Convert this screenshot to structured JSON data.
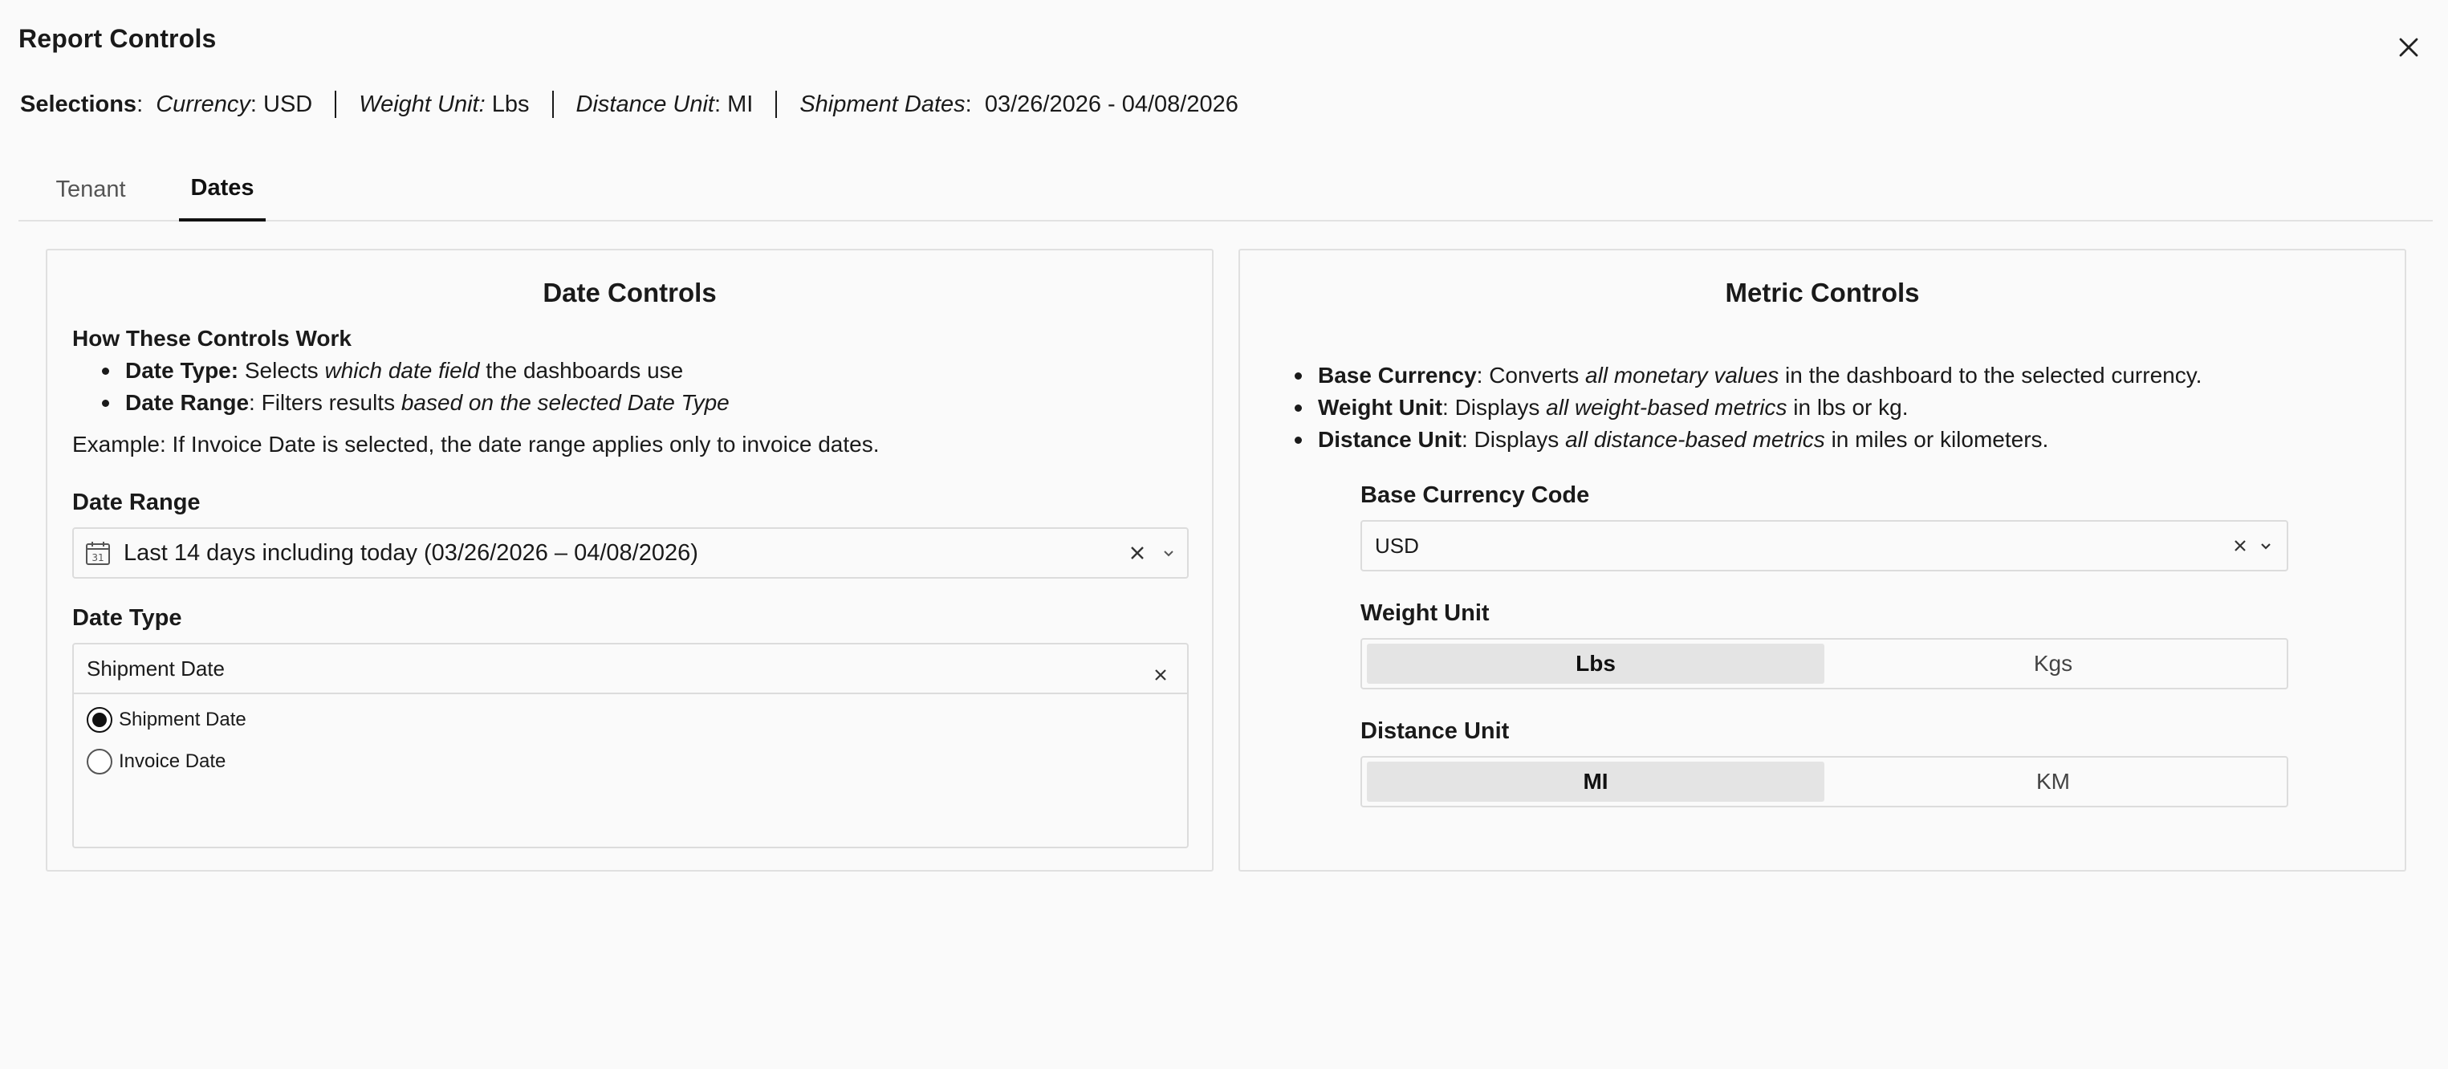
{
  "header": {
    "title": "Report Controls"
  },
  "selections": {
    "label": "Selections",
    "currency_label": "Currency",
    "currency_value": "USD",
    "weight_label": "Weight Unit:",
    "weight_value": "Lbs",
    "distance_label": "Distance Unit",
    "distance_value": "MI",
    "dates_label": "Shipment Dates",
    "dates_value": "03/26/2026 - 04/08/2026"
  },
  "tabs": [
    {
      "label": "Tenant",
      "active": false
    },
    {
      "label": "Dates",
      "active": true
    }
  ],
  "date_controls": {
    "title": "Date Controls",
    "how_heading": "How These Controls Work",
    "bullets": [
      {
        "term": "Date Type:",
        "pre": " Selects ",
        "emph": "which date field",
        "post": " the dashboards use"
      },
      {
        "term": "Date Range",
        "pre": ": Filters results ",
        "emph": "based on the selected Date Type",
        "post": ""
      }
    ],
    "example": "Example: If Invoice Date is selected, the date range applies only to invoice dates.",
    "date_range_label": "Date Range",
    "date_range_value": "Last 14 days including today (03/26/2026 – 04/08/2026)",
    "date_type_label": "Date Type",
    "date_type_value": "Shipment Date",
    "options": [
      {
        "label": "Shipment Date",
        "selected": true
      },
      {
        "label": "Invoice Date",
        "selected": false
      }
    ]
  },
  "metric_controls": {
    "title": "Metric Controls",
    "bullets": [
      {
        "term": "Base Currency",
        "pre": ": Converts ",
        "emph": "all monetary values",
        "post": " in the dashboard to the selected currency."
      },
      {
        "term": "Weight Unit",
        "pre": ": Displays ",
        "emph": "all weight-based metrics",
        "post": " in lbs or kg."
      },
      {
        "term": "Distance Unit",
        "pre": ": Displays ",
        "emph": "all distance-based metrics",
        "post": " in miles or kilometers."
      }
    ],
    "currency_label": "Base Currency Code",
    "currency_value": "USD",
    "weight_label": "Weight Unit",
    "weight_options": [
      "Lbs",
      "Kgs"
    ],
    "weight_selected": "Lbs",
    "distance_label": "Distance Unit",
    "distance_options": [
      "MI",
      "KM"
    ],
    "distance_selected": "MI"
  },
  "icons": {
    "close": "close-icon",
    "calendar": "calendar-icon",
    "clear": "clear-icon",
    "chevron": "chevron-down-icon",
    "calendar_day": "31"
  }
}
